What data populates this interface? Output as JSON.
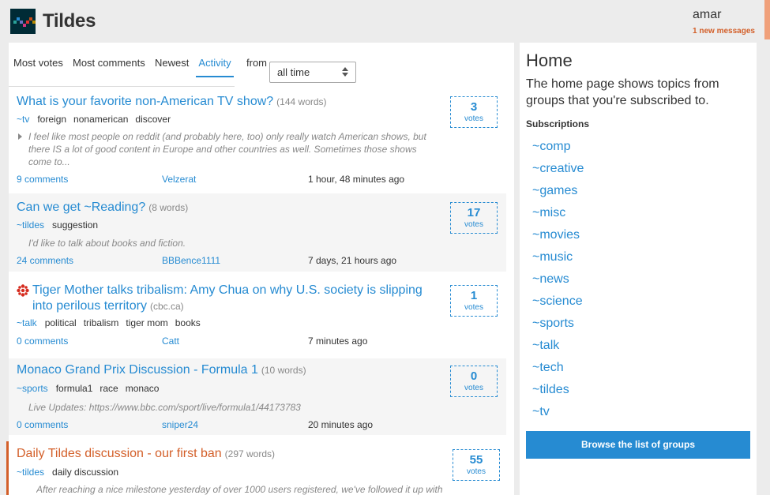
{
  "site": {
    "title": "Tildes"
  },
  "user": {
    "name": "amar",
    "messages": "1 new messages"
  },
  "tabs": [
    "Most votes",
    "Most comments",
    "Newest",
    "Activity"
  ],
  "period": {
    "label": "from",
    "value": "all time"
  },
  "topics": [
    {
      "title": "What is your favorite non-American TV show?",
      "meta": "(144 words)",
      "group": "~tv",
      "tags": [
        "foreign",
        "nonamerican",
        "discover"
      ],
      "excerpt": "I feel like most people on reddit (and probably here, too) only really watch American shows, but there IS a lot of good content in Europe and other countries as well. Sometimes those shows come to...",
      "comments": "9 comments",
      "author": "Velzerat",
      "time": "1 hour, 48 minutes ago",
      "votes": "3",
      "votes_label": "votes"
    },
    {
      "title": "Can we get ~Reading?",
      "meta": "(8 words)",
      "group": "~tildes",
      "tags": [
        "suggestion"
      ],
      "excerpt": "I'd like to talk about books and fiction.",
      "comments": "24 comments",
      "author": "BBBence1111",
      "time": "7 days, 21 hours ago",
      "votes": "17",
      "votes_label": "votes"
    },
    {
      "title_line1": "Tiger Mother talks tribalism: Amy Chua on why U.S. society is slipping",
      "title_line2": "into perilous territory",
      "meta": "(cbc.ca)",
      "group": "~talk",
      "tags": [
        "political",
        "tribalism",
        "tiger mom",
        "books"
      ],
      "comments": "0 comments",
      "author": "Catt",
      "time": "7 minutes ago",
      "votes": "1",
      "votes_label": "votes"
    },
    {
      "title": "Monaco Grand Prix Discussion - Formula 1",
      "meta": "(10 words)",
      "group": "~sports",
      "tags": [
        "formula1",
        "race",
        "monaco"
      ],
      "excerpt": "Live Updates: https://www.bbc.com/sport/live/formula1/44173783",
      "comments": "0 comments",
      "author": "sniper24",
      "time": "20 minutes ago",
      "votes": "0",
      "votes_label": "votes"
    },
    {
      "title": "Daily Tildes discussion - our first ban",
      "meta": "(297 words)",
      "group": "~tildes",
      "tags": [
        "daily discussion"
      ],
      "excerpt": "After reaching a nice milestone yesterday of over 1000 users registered, we've followed it up with",
      "votes": "55",
      "votes_label": "votes"
    }
  ],
  "sidebar": {
    "title": "Home",
    "description": "The home page shows topics from groups that you're subscribed to.",
    "subscriptions_title": "Subscriptions",
    "groups": [
      "~comp",
      "~creative",
      "~games",
      "~misc",
      "~movies",
      "~music",
      "~news",
      "~science",
      "~sports",
      "~talk",
      "~tech",
      "~tildes",
      "~tv"
    ],
    "browse_label": "Browse the list of groups"
  },
  "colors": {
    "link": "#268bd2",
    "accent": "#d35f29",
    "background": "#ececec"
  }
}
